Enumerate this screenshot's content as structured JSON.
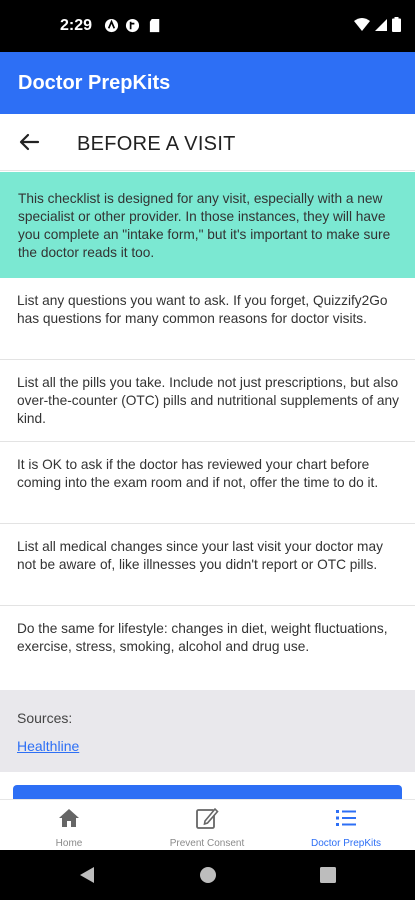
{
  "status_bar": {
    "time": "2:29",
    "icons": [
      "vpn-key-icon",
      "notification-icon",
      "sd-card-icon"
    ],
    "right_icons": [
      "wifi-icon",
      "signal-icon",
      "battery-icon"
    ]
  },
  "app_bar": {
    "title": "Doctor PrepKits"
  },
  "header": {
    "back_icon": "arrow-left-icon",
    "title": "BEFORE A VISIT"
  },
  "intro": {
    "text": "This checklist is designed for any visit, especially with a new specialist or other provider. In those instances, they will have you complete an \"intake form,\" but it's important to make sure the doctor reads it too.",
    "bg_color": "#7be8d2"
  },
  "items": [
    {
      "text": "List any questions you want to ask. If you forget, Quizzify2Go has questions for many common reasons for doctor visits."
    },
    {
      "text": "List all the pills you take. Include not just prescriptions, but also over-the-counter (OTC) pills and nutritional supplements of any kind."
    },
    {
      "text": "It is OK to ask if the doctor has reviewed your chart before coming into the exam room and if not, offer the time to do it."
    },
    {
      "text": "List all medical changes since your last visit your doctor may not be aware of, like illnesses you didn't report or OTC pills."
    },
    {
      "text": "Do the same for lifestyle: changes in diet, weight fluctuations, exercise, stress, smoking, alcohol and drug use."
    }
  ],
  "sources": {
    "label": "Sources:",
    "link": "Healthline"
  },
  "bottom_nav": [
    {
      "label": "Home",
      "icon": "home-icon",
      "active": false
    },
    {
      "label": "Prevent Consent",
      "icon": "edit-icon",
      "active": false
    },
    {
      "label": "Doctor PrepKits",
      "icon": "list-icon",
      "active": true
    }
  ],
  "colors": {
    "primary": "#2d6ff5",
    "accent": "#7be8d2",
    "sources_bg": "#e9e8ec"
  }
}
